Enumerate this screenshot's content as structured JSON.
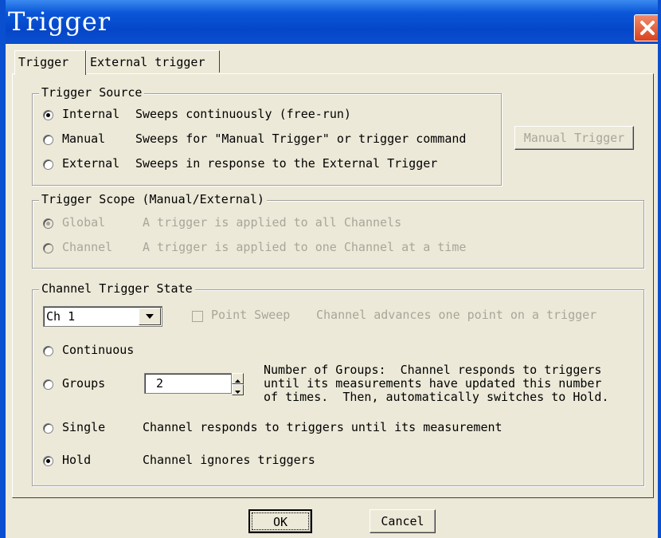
{
  "dialog": {
    "title": "Trigger"
  },
  "tabs": [
    {
      "label": "Trigger",
      "active": true
    },
    {
      "label": "External trigger",
      "active": false
    }
  ],
  "trigger_source": {
    "legend": "Trigger Source",
    "options": [
      {
        "label": "Internal",
        "desc": "Sweeps continuously (free-run)",
        "selected": true
      },
      {
        "label": "Manual",
        "desc": "Sweeps for \"Manual Trigger\" or trigger command",
        "selected": false
      },
      {
        "label": "External",
        "desc": "Sweeps in response to the External Trigger",
        "selected": false
      }
    ],
    "manual_trigger_button": "Manual Trigger"
  },
  "trigger_scope": {
    "legend": "Trigger Scope (Manual/External)",
    "options": [
      {
        "label": "Global",
        "desc": "A trigger is applied to all Channels",
        "selected": true,
        "enabled": false
      },
      {
        "label": "Channel",
        "desc": "A trigger is applied to one Channel at a time",
        "selected": false,
        "enabled": false
      }
    ]
  },
  "channel_trigger_state": {
    "legend": "Channel Trigger State",
    "channel_select": "Ch 1",
    "point_sweep": {
      "label": "Point Sweep",
      "desc": "Channel advances one point on a trigger",
      "checked": false,
      "enabled": false
    },
    "options": [
      {
        "label": "Continuous",
        "selected": false
      },
      {
        "label": "Groups",
        "selected": false
      },
      {
        "label": "Single",
        "desc": "Channel responds to triggers until its measurement",
        "selected": false
      },
      {
        "label": "Hold",
        "desc": "Channel ignores triggers",
        "selected": true
      }
    ],
    "groups_value": "2",
    "groups_desc": [
      "Number of Groups:  Channel responds to triggers",
      "until its measurements have updated this number",
      "of times.  Then, automatically switches to Hold."
    ]
  },
  "buttons": {
    "ok": "OK",
    "cancel": "Cancel"
  }
}
